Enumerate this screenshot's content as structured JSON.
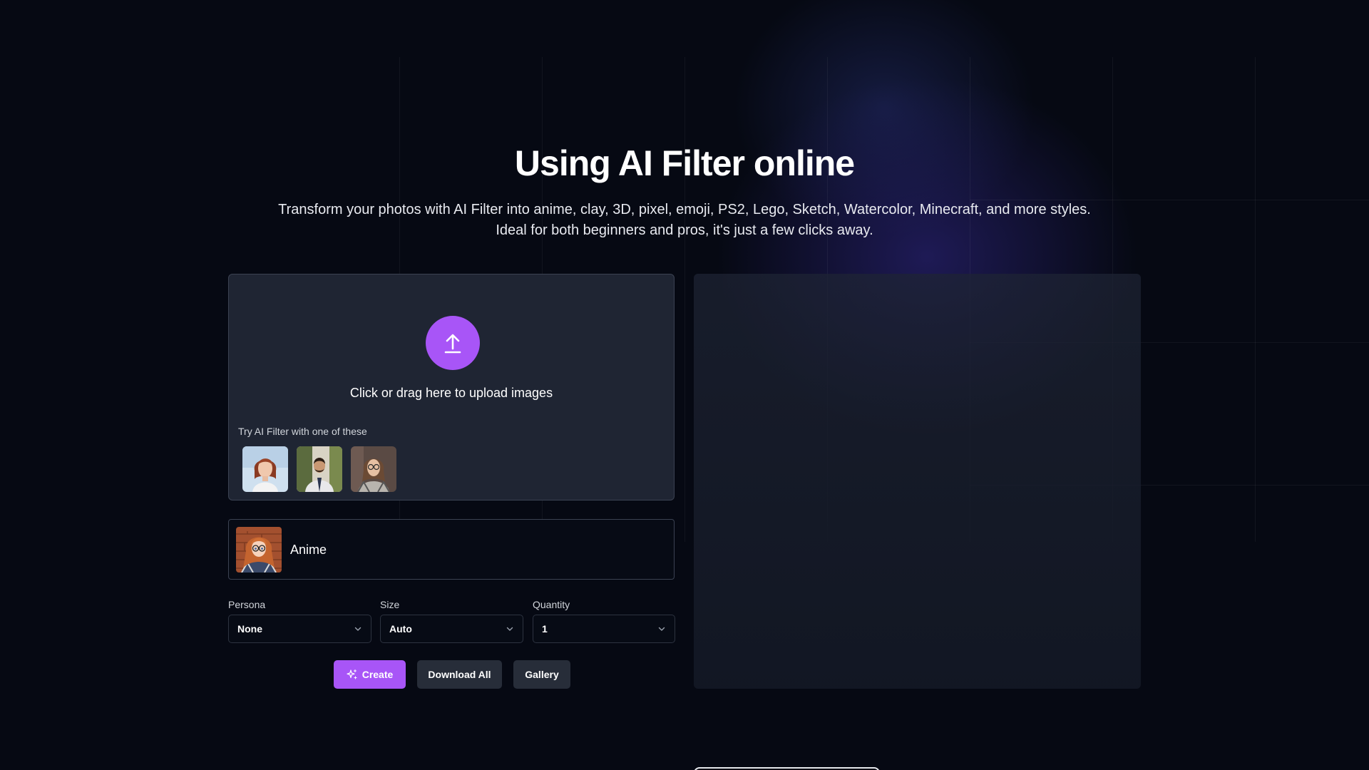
{
  "hero": {
    "title": "Using AI Filter online",
    "subtitle": "Transform your photos with AI Filter into anime, clay, 3D, pixel, emoji, PS2, Lego, Sketch, Watercolor, Minecraft, and more styles. Ideal for both beginners and pros, it's just a few clicks away."
  },
  "upload": {
    "icon": "upload-arrow-icon",
    "prompt": "Click or drag here to upload images",
    "samples_label": "Try AI Filter with one of these",
    "samples": [
      "sample-woman-red-hair",
      "sample-man-suit",
      "sample-woman-glasses"
    ]
  },
  "style": {
    "name": "Anime"
  },
  "options": {
    "persona": {
      "label": "Persona",
      "value": "None"
    },
    "size": {
      "label": "Size",
      "value": "Auto"
    },
    "quantity": {
      "label": "Quantity",
      "value": "1"
    }
  },
  "actions": {
    "create_label": "Create",
    "download_label": "Download All",
    "gallery_label": "Gallery"
  },
  "colors": {
    "accent": "#a855f7",
    "background": "#060913",
    "panel": "#1f2533"
  }
}
